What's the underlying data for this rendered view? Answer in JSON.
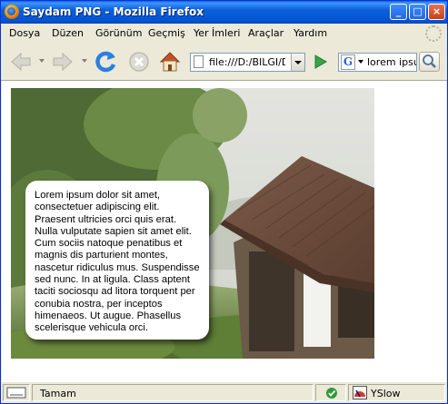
{
  "window": {
    "title": "Saydam PNG - Mozilla Firefox",
    "controls": {
      "minimize": "_",
      "maximize": "□",
      "close": "×"
    }
  },
  "menu": {
    "items": [
      "Dosya",
      "Düzen",
      "Görünüm",
      "Geçmiş",
      "Yer İmleri",
      "Araçlar",
      "Yardım"
    ]
  },
  "toolbar": {
    "back_icon": "back-arrow-icon",
    "forward_icon": "forward-arrow-icon",
    "reload_icon": "reload-icon",
    "stop_icon": "stop-icon",
    "home_icon": "home-icon",
    "url": "file:///D:/BILGI/D",
    "search_engine": "G",
    "search_value": "lorem ipsum"
  },
  "content": {
    "bubble_text": "Lorem ipsum dolor sit amet, consectetuer adipiscing elit. Praesent ultricies orci quis erat. Nulla vulputate sapien sit amet elit. Cum sociis natoque penatibus et magnis dis parturient montes, nascetur ridiculus mus. Suspendisse sed nunc. In at ligula. Class aptent taciti sociosqu ad litora torquent per conubia nostra, per inceptos himenaeos. Ut augue. Phasellus scelerisque vehicula orci."
  },
  "status": {
    "text": "Tamam",
    "yslow_label": "YSlow"
  },
  "colors": {
    "titlebar": "#0a5fd8",
    "go_green": "#3aa34a",
    "reload_blue": "#2a7fe0"
  }
}
